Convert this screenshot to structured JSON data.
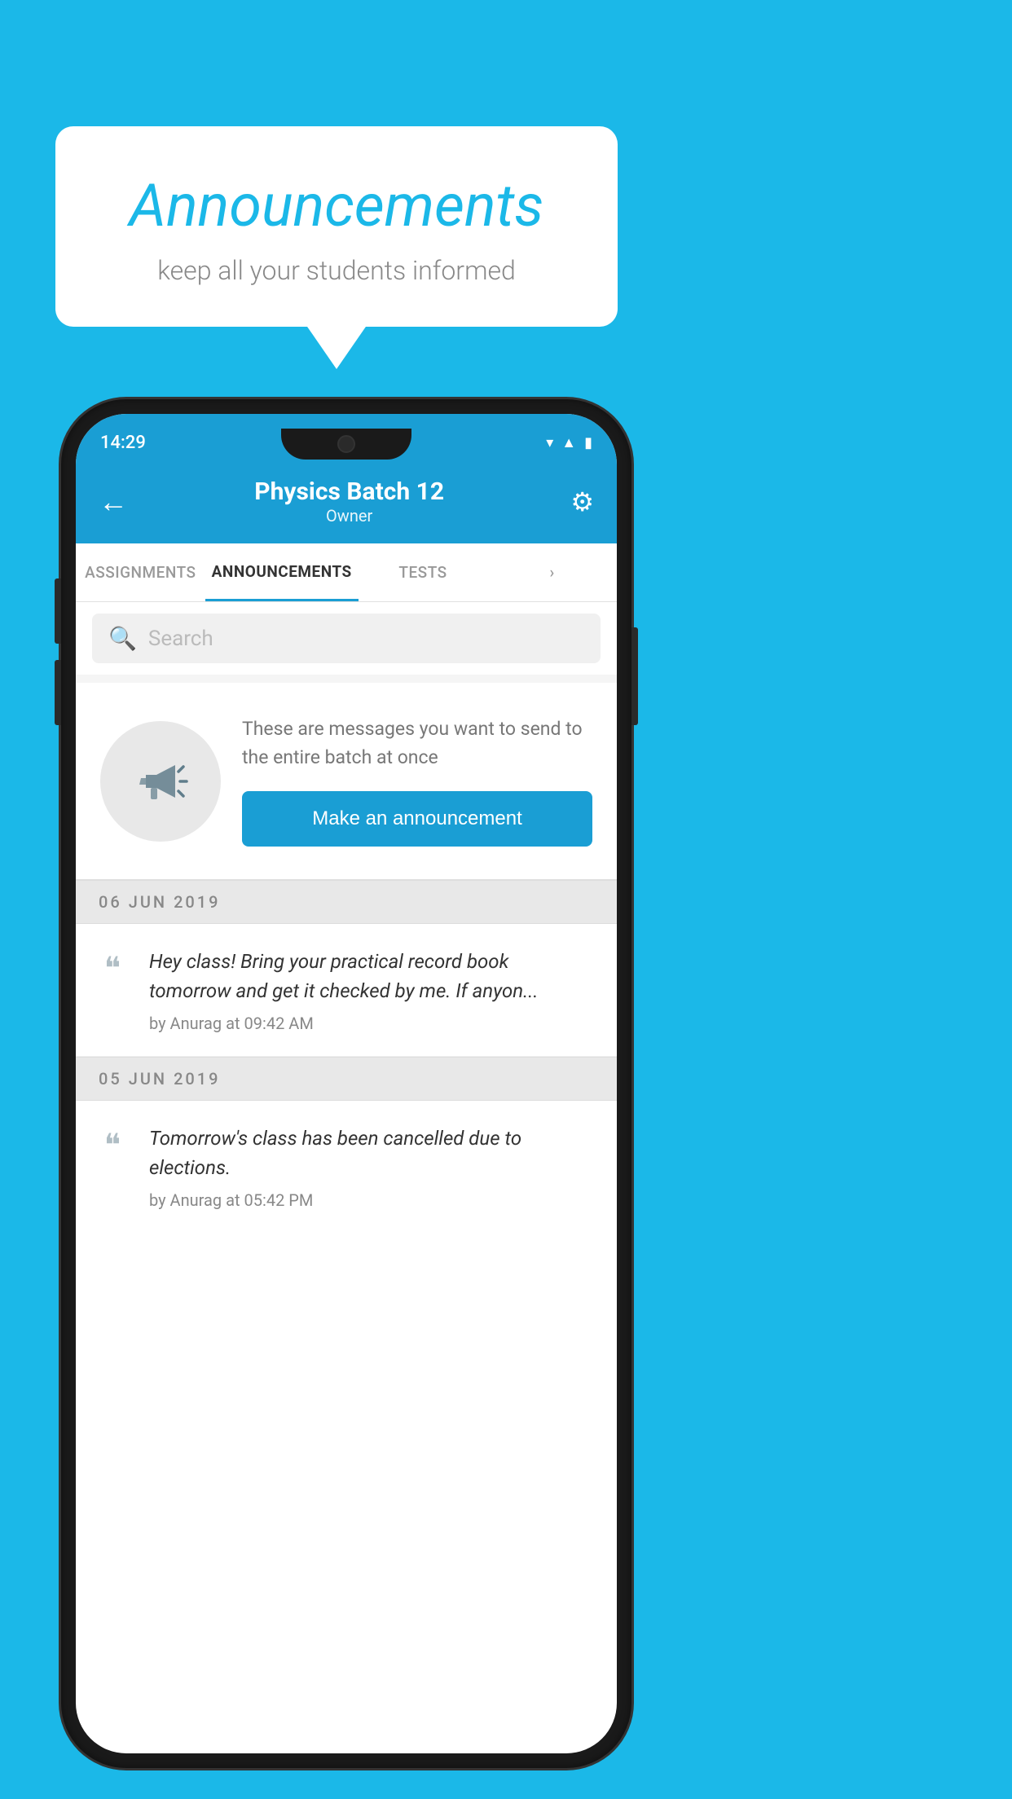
{
  "background": {
    "color": "#1BB8E8"
  },
  "speech_bubble": {
    "title": "Announcements",
    "subtitle": "keep all your students informed"
  },
  "phone": {
    "status_bar": {
      "time": "14:29",
      "icons": [
        "wifi",
        "signal",
        "battery"
      ]
    },
    "header": {
      "title": "Physics Batch 12",
      "subtitle": "Owner",
      "back_label": "←",
      "gear_label": "⚙"
    },
    "tabs": [
      {
        "label": "ASSIGNMENTS",
        "active": false
      },
      {
        "label": "ANNOUNCEMENTS",
        "active": true
      },
      {
        "label": "TESTS",
        "active": false
      },
      {
        "label": "",
        "active": false
      }
    ],
    "search": {
      "placeholder": "Search"
    },
    "intro_card": {
      "description": "These are messages you want to send to the entire batch at once",
      "button_label": "Make an announcement"
    },
    "announcements": [
      {
        "date": "06  JUN  2019",
        "text": "Hey class! Bring your practical record book tomorrow and get it checked by me. If anyon...",
        "meta": "by Anurag at 09:42 AM"
      },
      {
        "date": "05  JUN  2019",
        "text": "Tomorrow's class has been cancelled due to elections.",
        "meta": "by Anurag at 05:42 PM"
      }
    ]
  }
}
